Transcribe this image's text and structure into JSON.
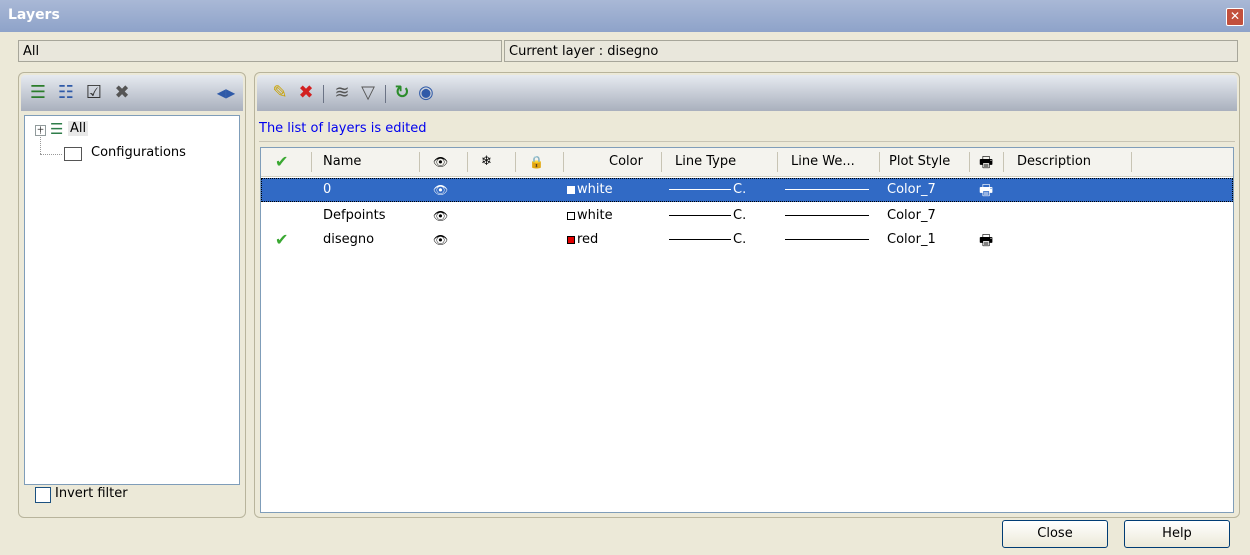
{
  "window": {
    "title": "Layers",
    "close_glyph": "✕"
  },
  "filter_field": {
    "value": "All"
  },
  "current_layer": {
    "text": "Current layer : disegno"
  },
  "left_panel": {
    "tree": [
      {
        "label": "All",
        "expanded": false,
        "selected": true
      },
      {
        "label": "Configurations"
      }
    ],
    "invert_filter": {
      "label": "Invert filter",
      "checked": false
    }
  },
  "status": {
    "text": "The list of layers is edited"
  },
  "columns": {
    "current": "✔",
    "name": "Name",
    "on": "👁",
    "freeze": "❄",
    "lock": "🔒",
    "color": "Color",
    "line_type": "Line Type",
    "line_weight": "Line We...",
    "plot_style": "Plot Style",
    "plot": "🖶",
    "description": "Description"
  },
  "layers": [
    {
      "current": "",
      "name": "0",
      "on": "👁",
      "color_name": "white",
      "color_hex": "#ffffff",
      "line_type": "C.",
      "plot_style": "Color_7",
      "plot": "🖶",
      "selected": true
    },
    {
      "current": "",
      "name": "Defpoints",
      "on": "👁",
      "color_name": "white",
      "color_hex": "#ffffff",
      "line_type": "C.",
      "plot_style": "Color_7",
      "plot": "",
      "selected": false
    },
    {
      "current": "✔",
      "name": "disegno",
      "on": "👁",
      "color_name": "red",
      "color_hex": "#e00000",
      "line_type": "C.",
      "plot_style": "Color_1",
      "plot": "🖶",
      "selected": false
    }
  ],
  "buttons": {
    "close": "Close",
    "help": "Help"
  },
  "colors": {
    "selection": "#316ac5",
    "status_text": "#0000ee",
    "check": "#3aa832",
    "delete": "#d22020"
  }
}
